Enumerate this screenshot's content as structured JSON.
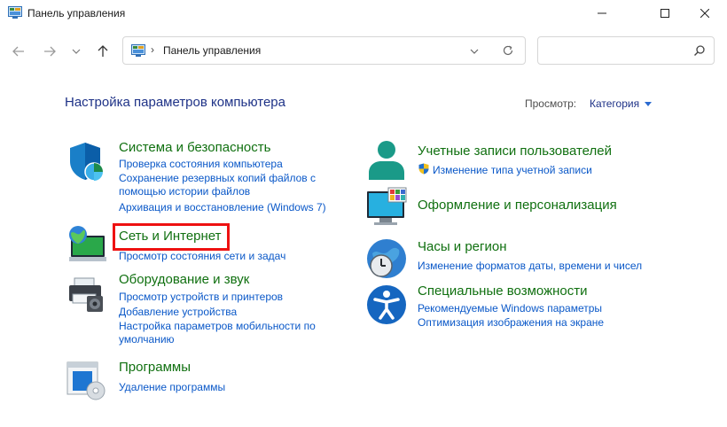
{
  "window": {
    "title": "Панель управления"
  },
  "address": {
    "path": "Панель управления",
    "separator": "›"
  },
  "search": {
    "placeholder": ""
  },
  "header": {
    "title": "Настройка параметров компьютера",
    "view_label": "Просмотр:",
    "view_value": "Категория"
  },
  "categories": [
    {
      "title": "Система и безопасность",
      "links": [
        "Проверка состояния компьютера",
        "Сохранение резервных копий файлов с",
        "помощью истории файлов",
        "Архивация и восстановление (Windows 7)"
      ]
    },
    {
      "title": "Сеть и Интернет",
      "links": [
        "Просмотр состояния сети и задач"
      ]
    },
    {
      "title": "Оборудование и звук",
      "links": [
        "Просмотр устройств и принтеров",
        "Добавление устройства",
        "Настройка параметров мобильности по",
        "умолчанию"
      ]
    },
    {
      "title": "Программы",
      "links": [
        "Удаление программы"
      ]
    },
    {
      "title": "Учетные записи пользователей",
      "links": [
        "Изменение типа учетной записи"
      ]
    },
    {
      "title": "Оформление и персонализация",
      "links": []
    },
    {
      "title": "Часы и регион",
      "links": [
        "Изменение форматов даты, времени и чисел"
      ]
    },
    {
      "title": "Специальные возможности",
      "links": [
        "Рекомендуемые Windows параметры",
        "Оптимизация изображения на экране"
      ]
    }
  ],
  "colors": {
    "title_blue": "#1e3287",
    "category_green": "#107010",
    "link_blue": "#0a58c8",
    "highlight_red": "#ee1111"
  },
  "icons": {
    "app": "control-panel-icon",
    "back": "arrow-left-icon",
    "forward": "arrow-right-icon",
    "recent": "chevron-down-icon",
    "up": "arrow-up-icon",
    "refresh": "refresh-icon",
    "search": "search-icon"
  }
}
